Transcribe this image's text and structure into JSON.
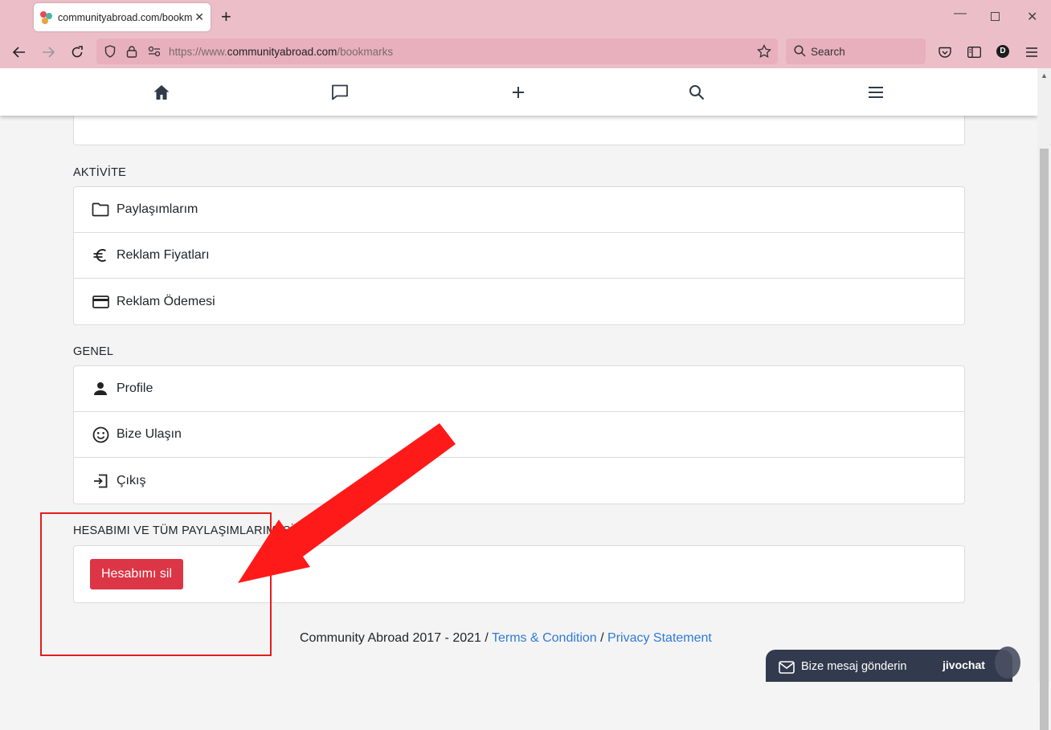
{
  "browser": {
    "tab_title": "communityabroad.com/bookmarks",
    "url_host": "https://www.",
    "url_domain": "communityabroad.com",
    "url_path": "/bookmarks",
    "search_placeholder": "Search",
    "profile_initial": "D"
  },
  "sections": {
    "activity": {
      "title": "AKTİVİTE",
      "items": [
        {
          "label": "Paylaşımlarım",
          "icon": "folder-icon"
        },
        {
          "label": "Reklam Fiyatları",
          "icon": "euro-icon"
        },
        {
          "label": "Reklam Ödemesi",
          "icon": "credit-card-icon"
        }
      ]
    },
    "general": {
      "title": "GENEL",
      "items": [
        {
          "label": "Profile",
          "icon": "person-icon"
        },
        {
          "label": "Bize Ulaşın",
          "icon": "smiley-icon"
        },
        {
          "label": "Çıkış",
          "icon": "logout-icon"
        }
      ]
    },
    "delete": {
      "title": "HESABIMI VE TÜM PAYLAŞIMLARIMI SİL",
      "button_label": "Hesabımı sil"
    }
  },
  "footer": {
    "text": "Community Abroad 2017 - 2021 / ",
    "terms": "Terms & Condition",
    "separator": " / ",
    "privacy": "Privacy Statement"
  },
  "chat": {
    "label": "Bize mesaj gönderin",
    "brand": "jivochat"
  },
  "colors": {
    "browser_chrome": "#ecbfc8",
    "danger": "#dc3545",
    "link": "#2f7ad6",
    "annotation": "#e31d1d"
  }
}
